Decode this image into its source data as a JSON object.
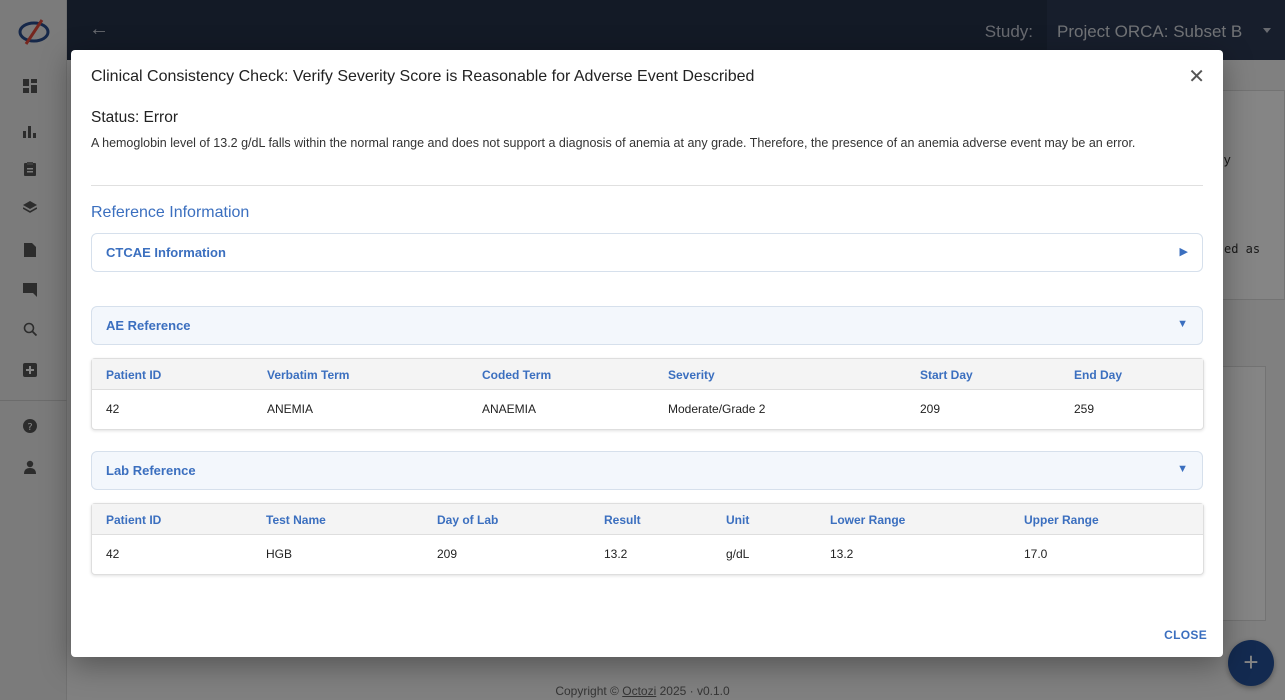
{
  "app": {
    "study_label": "Study:",
    "study_value": "Project ORCA: Subset B",
    "footer_prefix": "Copyright ©",
    "footer_link": "Octozi",
    "footer_suffix": "2025 · v0.1.0"
  },
  "sidebar": {
    "icons": [
      "dashboard-icon",
      "bar-chart-icon",
      "clipboard-icon",
      "layers-icon",
      "document-icon",
      "chat-icon",
      "search-zoom-icon",
      "plus-box-icon",
      "help-icon",
      "user-icon"
    ]
  },
  "background": {
    "frag_y": "y",
    "frag_ed_as": "ed as"
  },
  "modal": {
    "title": "Clinical Consistency Check: Verify Severity Score is Reasonable for Adverse Event Described",
    "status": "Status: Error",
    "status_text": "A hemoglobin level of 13.2 g/dL falls within the normal range and does not support a diagnosis of anemia at any grade. Therefore, the presence of an anemia adverse event may be an error.",
    "reference_title": "Reference Information",
    "ctcae_label": "CTCAE Information",
    "ae_label": "AE Reference",
    "lab_label": "Lab Reference",
    "close_label": "CLOSE",
    "ae_table": {
      "headers": [
        "Patient ID",
        "Verbatim Term",
        "Coded Term",
        "Severity",
        "Start Day",
        "End Day"
      ],
      "rows": [
        [
          "42",
          "ANEMIA",
          "ANAEMIA",
          "Moderate/Grade 2",
          "209",
          "259"
        ]
      ]
    },
    "lab_table": {
      "headers": [
        "Patient ID",
        "Test Name",
        "Day of Lab",
        "Result",
        "Unit",
        "Lower Range",
        "Upper Range"
      ],
      "rows": [
        [
          "42",
          "HGB",
          "209",
          "13.2",
          "g/dL",
          "13.2",
          "17.0"
        ]
      ]
    }
  },
  "colors": {
    "topbar": "#25324a",
    "accent": "#3b6fbf",
    "fab": "#26519a"
  }
}
